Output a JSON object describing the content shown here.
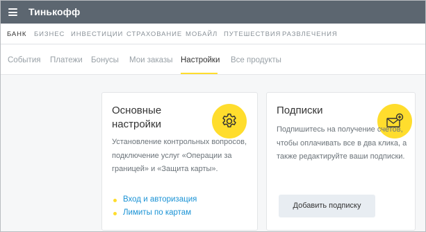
{
  "header": {
    "brand": "Тинькофф",
    "menu_icon": "hamburger-menu-icon",
    "background_color": "#5c6670"
  },
  "main_nav": {
    "items": [
      {
        "label": "Банк",
        "active": true
      },
      {
        "label": "Бизнес",
        "active": false
      },
      {
        "label": "Инвестиции",
        "active": false
      },
      {
        "label": "Страхование",
        "active": false
      },
      {
        "label": "Мобайл",
        "active": false
      },
      {
        "label": "Путешествия",
        "active": false
      },
      {
        "label": "Развлечения",
        "active": false
      }
    ]
  },
  "sub_nav": {
    "tabs": [
      {
        "label": "События",
        "active": false
      },
      {
        "label": "Платежи",
        "active": false
      },
      {
        "label": "Бонусы",
        "active": false
      },
      {
        "label": "Мои заказы",
        "active": false
      },
      {
        "label": "Настройки",
        "active": true
      },
      {
        "label": "Все продукты",
        "active": false
      }
    ],
    "accent_color": "#ffdd2d"
  },
  "cards": {
    "settings": {
      "title": "Основные настройки",
      "icon": "gear-icon",
      "description": "Установление контрольных вопросов, подключение услуг «Операции за границей» и «Защита карты».",
      "links": [
        {
          "label": "Вход и авторизация"
        },
        {
          "label": "Лимиты по картам"
        }
      ]
    },
    "subscriptions": {
      "title": "Подписки",
      "icon": "envelope-add-icon",
      "description": "Подпишитесь на получение счетов, чтобы оплачивать все в два клика, а также редактируйте ваши подписки.",
      "button_label": "Добавить подписку"
    }
  },
  "colors": {
    "accent_yellow": "#ffdd2d",
    "link_blue": "#1992d5",
    "button_bg": "#e8edf2"
  }
}
